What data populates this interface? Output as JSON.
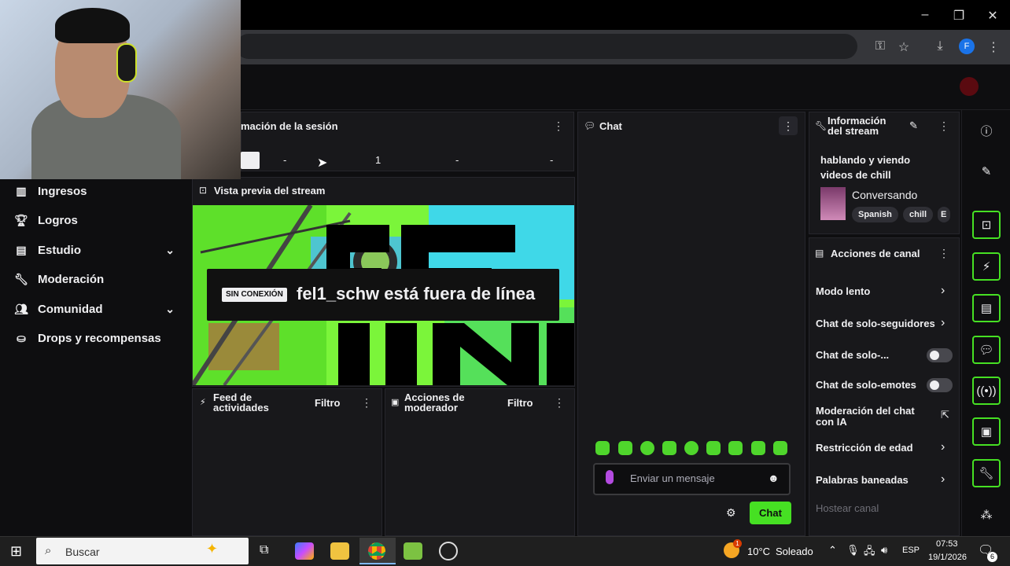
{
  "browser": {
    "window_controls": {
      "minimize": "–",
      "maximize": "❐",
      "close": "✕"
    },
    "profile_initial": "F"
  },
  "session_panel": {
    "title": "mación de la sesión",
    "values": [
      "-",
      "1",
      "-",
      "-"
    ]
  },
  "sidebar": {
    "items": [
      {
        "label": "Ingresos",
        "icon": "chart-bars-icon",
        "has_chevron": false
      },
      {
        "label": "Logros",
        "icon": "trophy-icon",
        "has_chevron": false
      },
      {
        "label": "Estudio",
        "icon": "studio-icon",
        "has_chevron": true
      },
      {
        "label": "Moderación",
        "icon": "wrench-icon",
        "has_chevron": false
      },
      {
        "label": "Comunidad",
        "icon": "people-icon",
        "has_chevron": true
      },
      {
        "label": "Drops y recompensas",
        "icon": "drops-icon",
        "has_chevron": false
      }
    ]
  },
  "preview_panel": {
    "title": "Vista previa del stream",
    "badge": "SIN CONEXIÓN",
    "offline_text": "fel1_schw está fuera de línea"
  },
  "activity_feed": {
    "title_line1": "Feed de",
    "title_line2": "actividades",
    "filter": "Filtro"
  },
  "mod_actions": {
    "title_line1": "Acciones de",
    "title_line2": "moderador",
    "filter": "Filtro"
  },
  "chat": {
    "title": "Chat",
    "placeholder": "Enviar un mensaje",
    "button": "Chat"
  },
  "stream_info": {
    "title_line1": "Información",
    "title_line2": "del stream",
    "stream_title": "hablando y viendo videos de chill",
    "category": "Conversando",
    "tags": [
      "Spanish",
      "chill",
      "E"
    ]
  },
  "channel_actions": {
    "title": "Acciones de canal",
    "items": [
      {
        "label": "Modo lento",
        "control": "arrow"
      },
      {
        "label": "Chat de solo-seguidores",
        "control": "arrow"
      },
      {
        "label": "Chat de solo-...",
        "control": "toggle"
      },
      {
        "label": "Chat de solo-emotes",
        "control": "toggle"
      },
      {
        "label": "Moderación del chat con IA",
        "control": "external"
      },
      {
        "label": "Restricción de edad",
        "control": "arrow"
      },
      {
        "label": "Palabras baneadas",
        "control": "arrow"
      },
      {
        "label": "Hostear canal",
        "control": "none"
      }
    ]
  },
  "taskbar": {
    "search_placeholder": "Buscar",
    "weather_temp": "10°C",
    "weather_desc": "Soleado",
    "weather_badge": "1",
    "language": "ESP",
    "time": "07:53",
    "date": "19/1/2026",
    "notification_count": "6"
  },
  "colors": {
    "accent": "#46e023",
    "panel": "#18181b",
    "background": "#0e0e10"
  }
}
